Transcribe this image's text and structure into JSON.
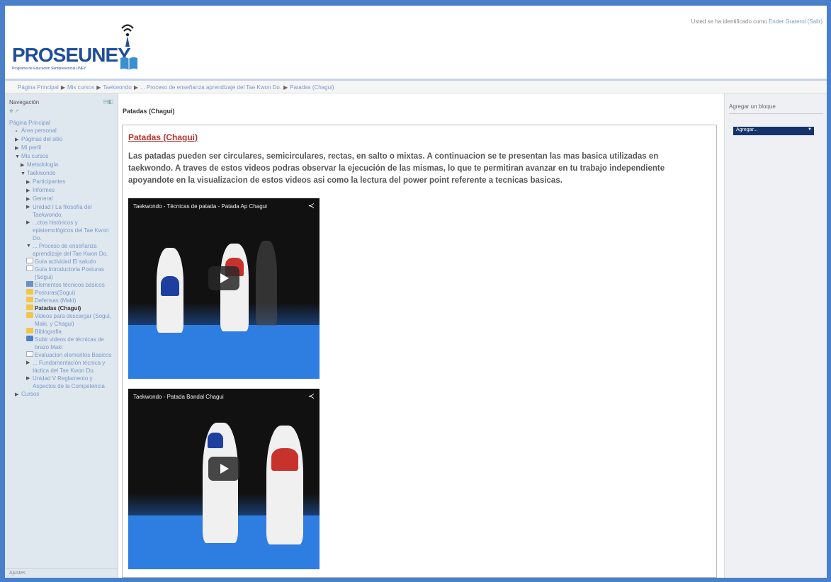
{
  "header": {
    "logo_text": "PROSEUNEY",
    "logo_sub": "Programa de Educación Semipresencial UNEY",
    "login_prefix": "Usted se ha identificado como",
    "login_user": "Ender Graterol",
    "login_logout": "(Salir)"
  },
  "breadcrumb": [
    "Página Principal",
    "Mis cursos",
    "Taekwondo",
    "... Proceso de enseñanza aprendizaje del Tae Kwon Do.",
    "Patadas (Chagui)"
  ],
  "navigation": {
    "title": "Navegación",
    "items": [
      {
        "label": "Página Principal"
      },
      {
        "label": "Área personal"
      },
      {
        "label": "Páginas del sitio"
      },
      {
        "label": "Mi perfil"
      },
      {
        "label": "Mis cursos"
      },
      {
        "label": "Metodología"
      },
      {
        "label": "Taekwondo"
      },
      {
        "label": "Participantes"
      },
      {
        "label": "Informes"
      },
      {
        "label": "General"
      },
      {
        "label": "Unidad I La filosofía del Taekwondo."
      },
      {
        "label": "...ctos históricos y epistemológicos del Tae Kwon Do."
      },
      {
        "label": "... Proceso de enseñanza aprendizaje del Tae Kwon Do."
      },
      {
        "label": "Guía actividad El saludo"
      },
      {
        "label": "Guía Introductoria Posturas (Sogui)"
      },
      {
        "label": "Elementos técnicos básicos"
      },
      {
        "label": "Posturas(Sogui)"
      },
      {
        "label": "Defensas (Maki)"
      },
      {
        "label": "Patadas (Chagui)"
      },
      {
        "label": "Videos para descargar (Sogui, Maki, y Chagui)"
      },
      {
        "label": "Biblografia"
      },
      {
        "label": "Subir videos de técnicas de brazo Maki"
      },
      {
        "label": "Evaluacion elementos Basicos"
      },
      {
        "label": "... Fundamentación técnica y táctica del Tae Kwon Do."
      },
      {
        "label": "Unidad V Reglamento y Aspectos de la Competencia"
      },
      {
        "label": "Cursos"
      }
    ]
  },
  "block2_title": "Ajustes",
  "main": {
    "page_title": "Patadas (Chagui)",
    "content_title": "Patadas (Chagui)",
    "content_text": "Las patadas pueden ser circulares, semicirculares, rectas, en salto o mixtas.  A continuacion se te presentan las mas basica utilizadas en taekwondo. A traves de estos videos podras observar la ejecución de las mismas, lo que te permitiran avanzar en tu trabajo independiente apoyandote en la visualizacion de estos videos asi como la lectura del power point referente a tecnicas basicas.",
    "videos": [
      {
        "title": "Taekwondo - Técnicas de patada - Patada Ap Chagui"
      },
      {
        "title": "Taekwondo - Patada Bandal Chagui"
      }
    ]
  },
  "right": {
    "add_block": "Agregar un bloque",
    "select_value": "Agregar..."
  },
  "colors": {
    "page_bg": "#4a7fc9",
    "logo": "#1f4e9a",
    "title_red": "#c0322d",
    "select_bg": "#16326a"
  }
}
